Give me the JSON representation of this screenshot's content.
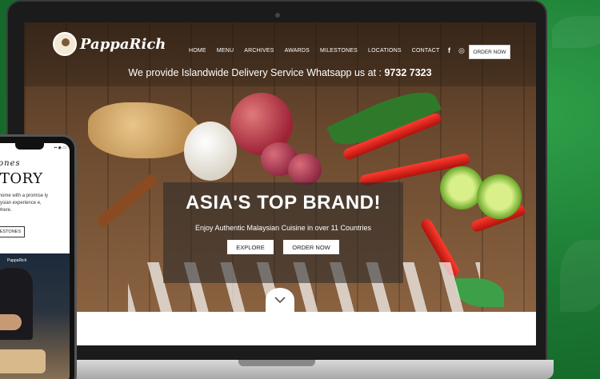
{
  "colors": {
    "background_green": "#1c7a33",
    "button_bg": "#ffffff",
    "text_light": "#ffffff"
  },
  "site": {
    "logo_text": "PappaRich",
    "nav": [
      "HOME",
      "MENU",
      "ARCHIVES",
      "AWARDS",
      "MILESTONES",
      "LOCATIONS",
      "CONTACT"
    ],
    "social_icons": [
      "facebook-icon",
      "instagram-icon"
    ],
    "social_glyphs": {
      "facebook": "f",
      "instagram": "◎"
    },
    "order_button": "ORDER NOW",
    "delivery_text": "We provide Islandwide Delivery Service Whatsapp us at :",
    "delivery_phone": "9732 7323",
    "hero": {
      "title": "ASIA'S TOP BRAND!",
      "subtitle": "Enjoy Authentic Malaysian Cuisine in over 11 Countries",
      "explore_button": "EXPLORE",
      "order_button": "ORDER NOW"
    }
  },
  "phone": {
    "status": "▪▪ ◉ ▭",
    "title_italic": "stones",
    "title": "STORY",
    "text": "e of home with a promise ly Malaysian experience e, anywhere.",
    "button": "ESTONES",
    "photo_logo": "PappaRich"
  }
}
